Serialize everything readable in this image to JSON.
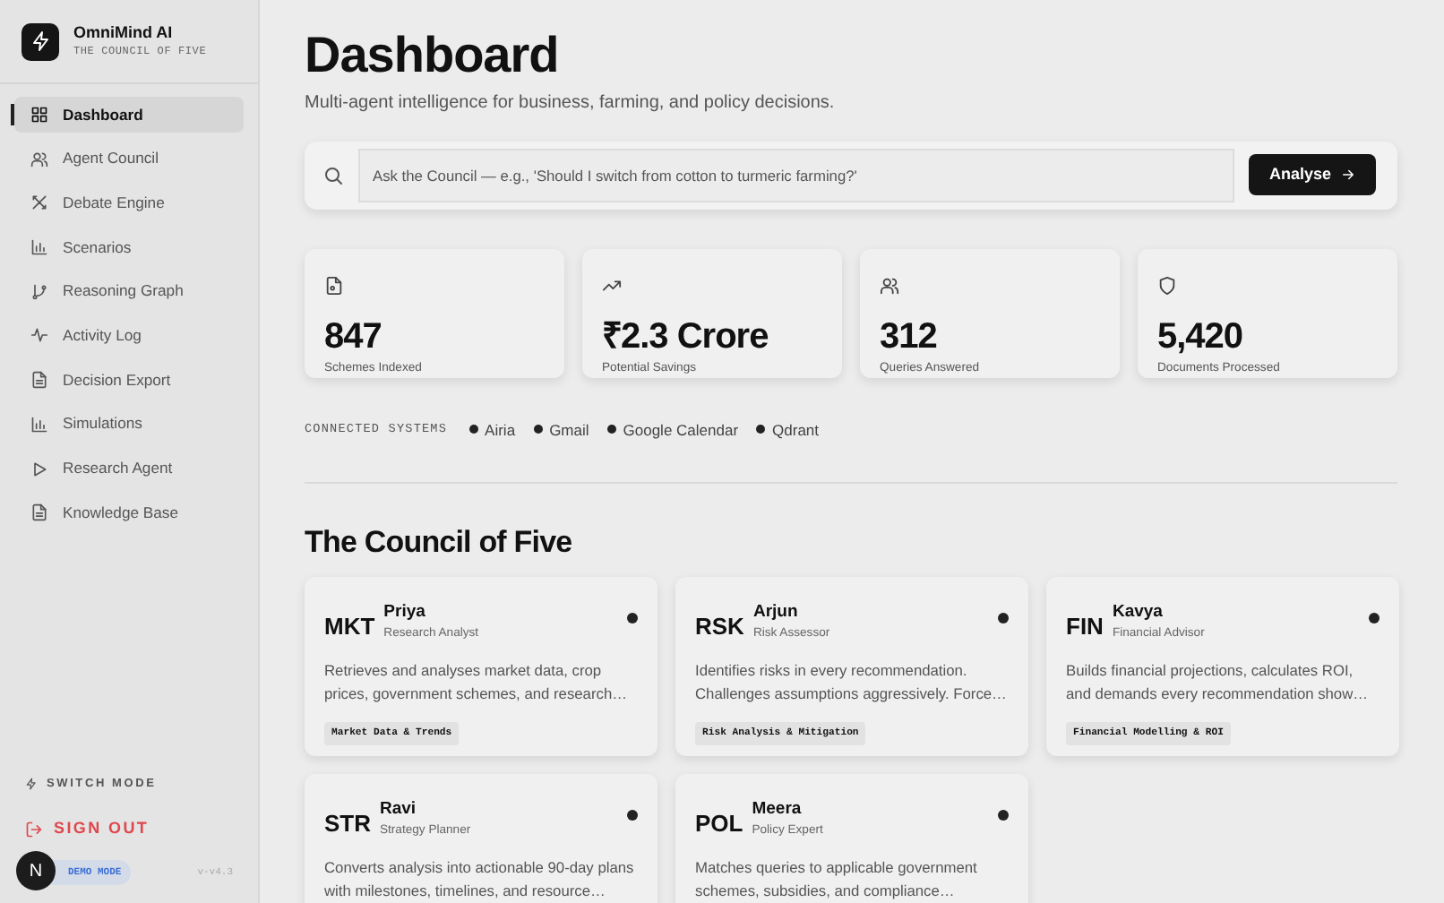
{
  "brand": {
    "name": "OmniMind AI",
    "tagline": "THE COUNCIL OF FIVE"
  },
  "nav": [
    {
      "label": "Dashboard",
      "selected": true
    },
    {
      "label": "Agent Council",
      "selected": false
    },
    {
      "label": "Debate Engine",
      "selected": false
    },
    {
      "label": "Scenarios",
      "selected": false
    },
    {
      "label": "Reasoning Graph",
      "selected": false
    },
    {
      "label": "Activity Log",
      "selected": false
    },
    {
      "label": "Decision Export",
      "selected": false
    },
    {
      "label": "Simulations",
      "selected": false
    },
    {
      "label": "Research Agent",
      "selected": false
    },
    {
      "label": "Knowledge Base",
      "selected": false
    }
  ],
  "sidebar_footer": {
    "switch_mode": "SWITCH MODE",
    "sign_out": "SIGN OUT",
    "mode_badge": "DEMO MODE",
    "version": "v-v4.3",
    "avatar": "N"
  },
  "page": {
    "title": "Dashboard",
    "subtitle": "Multi-agent intelligence for business, farming, and policy decisions."
  },
  "search": {
    "placeholder": "Ask the Council — e.g., 'Should I switch from cotton to turmeric farming?'",
    "button": "Analyse"
  },
  "stats": [
    {
      "value": "847",
      "label": "Schemes Indexed"
    },
    {
      "value": "₹2.3 Crore",
      "label": "Potential Savings"
    },
    {
      "value": "312",
      "label": "Queries Answered"
    },
    {
      "value": "5,420",
      "label": "Documents Processed"
    }
  ],
  "connected": {
    "label": "CONNECTED SYSTEMS",
    "systems": [
      "Airia",
      "Gmail",
      "Google Calendar",
      "Qdrant"
    ]
  },
  "council": {
    "title": "The Council of Five",
    "agents": [
      {
        "code": "MKT",
        "name": "Priya",
        "role": "Research Analyst",
        "description": "Retrieves and analyses market data, crop prices, government schemes, and research…",
        "tag": "Market Data & Trends"
      },
      {
        "code": "RSK",
        "name": "Arjun",
        "role": "Risk Assessor",
        "description": "Identifies risks in every recommendation. Challenges assumptions aggressively. Force…",
        "tag": "Risk Analysis & Mitigation"
      },
      {
        "code": "FIN",
        "name": "Kavya",
        "role": "Financial Advisor",
        "description": "Builds financial projections, calculates ROI, and demands every recommendation show…",
        "tag": "Financial Modelling & ROI"
      },
      {
        "code": "STR",
        "name": "Ravi",
        "role": "Strategy Planner",
        "description": "Converts analysis into actionable 90-day plans with milestones, timelines, and resource…"
      },
      {
        "code": "POL",
        "name": "Meera",
        "role": "Policy Expert",
        "description": "Matches queries to applicable government schemes, subsidies, and compliance…"
      }
    ]
  }
}
